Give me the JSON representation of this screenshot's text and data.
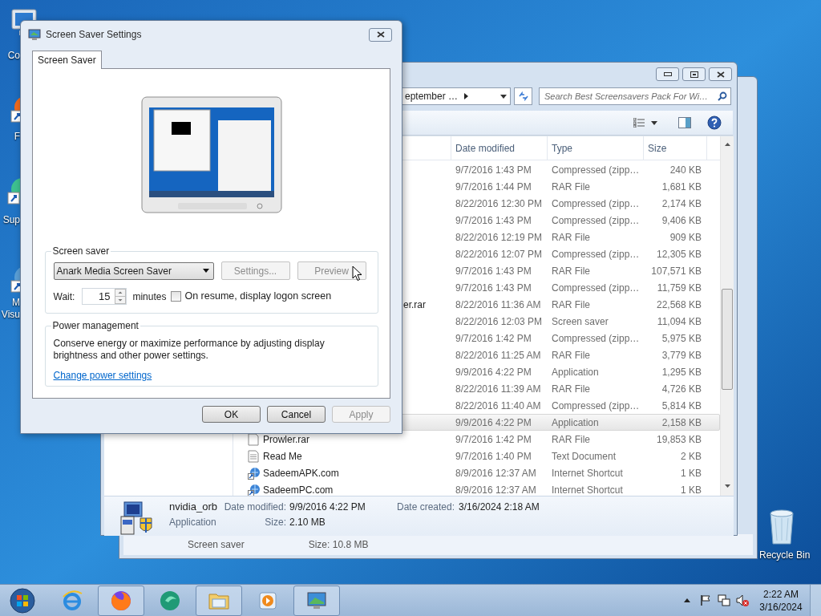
{
  "desktop_icons": [
    {
      "kind": "computer",
      "lines": [
        "Co"
      ]
    },
    {
      "kind": "browser",
      "lines": [
        "F"
      ]
    },
    {
      "kind": "sphere",
      "lines": [
        "Sup"
      ]
    },
    {
      "kind": "globe",
      "lines": [
        "M",
        "Visu"
      ]
    }
  ],
  "recycle_bin": {
    "label": "Recycle Bin"
  },
  "back_window": {
    "status_texts": [
      "Screen saver",
      "Size: 10.8 MB"
    ]
  },
  "explorer": {
    "address": "eptember …",
    "search": {
      "placeholder": "Search Best Screensavers Pack For Wi…"
    },
    "columns": [
      "Date modified",
      "Type",
      "Size"
    ],
    "rows": [
      {
        "kind": "hidden",
        "date": "9/7/2016 1:43 PM",
        "type": "Compressed (zipp…",
        "size": "240 KB",
        "selected": false
      },
      {
        "kind": "hidden",
        "date": "9/7/2016 1:44 PM",
        "type": "RAR File",
        "size": "1,681 KB",
        "selected": false
      },
      {
        "kind": "hidden",
        "date": "8/22/2016 12:30 PM",
        "type": "Compressed (zipp…",
        "size": "2,174 KB",
        "selected": false
      },
      {
        "kind": "hidden",
        "date": "9/7/2016 1:43 PM",
        "type": "Compressed (zipp…",
        "size": "9,406 KB",
        "selected": false
      },
      {
        "kind": "hidden",
        "date": "8/22/2016 12:19 PM",
        "type": "RAR File",
        "size": "909 KB",
        "selected": false
      },
      {
        "kind": "hidden",
        "date": "8/22/2016 12:07 PM",
        "type": "Compressed (zipp…",
        "size": "12,305 KB",
        "selected": false
      },
      {
        "kind": "hidden",
        "date": "9/7/2016 1:43 PM",
        "type": "RAR File",
        "size": "107,571 KB",
        "selected": false
      },
      {
        "kind": "hidden",
        "date": "9/7/2016 1:43 PM",
        "type": "Compressed (zipp…",
        "size": "11,759 KB",
        "selected": false
      },
      {
        "kind": "cut",
        "name": "er.rar",
        "date": "8/22/2016 11:36 AM",
        "type": "RAR File",
        "size": "22,568 KB",
        "selected": false
      },
      {
        "kind": "hidden",
        "date": "8/22/2016 12:03 PM",
        "type": "Screen saver",
        "size": "11,094 KB",
        "selected": false
      },
      {
        "kind": "hidden",
        "date": "9/7/2016 1:42 PM",
        "type": "Compressed (zipp…",
        "size": "5,975 KB",
        "selected": false
      },
      {
        "kind": "hidden",
        "date": "8/22/2016 11:25 AM",
        "type": "RAR File",
        "size": "3,779 KB",
        "selected": false
      },
      {
        "kind": "hidden",
        "date": "9/9/2016 4:22 PM",
        "type": "Application",
        "size": "1,295 KB",
        "selected": false
      },
      {
        "kind": "hidden",
        "date": "8/22/2016 11:39 AM",
        "type": "RAR File",
        "size": "4,726 KB",
        "selected": false
      },
      {
        "kind": "hidden",
        "date": "8/22/2016 11:40 AM",
        "type": "Compressed (zipp…",
        "size": "5,814 KB",
        "selected": false
      },
      {
        "kind": "hidden",
        "date": "9/9/2016 4:22 PM",
        "type": "Application",
        "size": "2,158 KB",
        "selected": true
      },
      {
        "kind": "rar",
        "name": "Prowler.rar",
        "date": "9/7/2016 1:42 PM",
        "type": "RAR File",
        "size": "19,853 KB",
        "selected": false
      },
      {
        "kind": "text",
        "name": "Read Me",
        "date": "9/7/2016 1:40 PM",
        "type": "Text Document",
        "size": "2 KB",
        "selected": false
      },
      {
        "kind": "shortcut",
        "name": "SadeemAPK.com",
        "date": "8/9/2016 12:37 AM",
        "type": "Internet Shortcut",
        "size": "1 KB",
        "selected": false
      },
      {
        "kind": "shortcut",
        "name": "SadeemPC.com",
        "date": "8/9/2016 12:37 AM",
        "type": "Internet Shortcut",
        "size": "1 KB",
        "selected": false
      }
    ],
    "details": {
      "name": "nvidia_orb",
      "type": "Application",
      "modified_label": "Date modified:",
      "modified": "9/9/2016 4:22 PM",
      "size_label": "Size:",
      "size": "2.10 MB",
      "created_label": "Date created:",
      "created": "3/16/2024 2:18 AM"
    }
  },
  "dialog": {
    "title": "Screen Saver Settings",
    "tabs": [
      {
        "label": "Screen Saver",
        "selected": true
      }
    ],
    "screen_saver_group": {
      "legend": "Screen saver",
      "dropdown": "Anark Media Screen Saver",
      "buttons": [
        {
          "label": "Settings...",
          "disabled": true
        },
        {
          "label": "Preview",
          "disabled": true
        }
      ],
      "wait_label": "Wait:",
      "wait_value": "15",
      "wait_unit": "minutes",
      "logon_checkbox": {
        "label": "On resume, display logon screen",
        "checked": false
      }
    },
    "power_group": {
      "legend": "Power management",
      "text": "Conserve energy or maximize performance by adjusting display brightness and other power settings.",
      "link": "Change power settings"
    },
    "buttons": [
      {
        "label": "OK",
        "disabled": false
      },
      {
        "label": "Cancel",
        "disabled": false
      },
      {
        "label": "Apply",
        "disabled": true
      }
    ]
  },
  "taskbar": {
    "apps": [
      {
        "kind": "ie",
        "running": false
      },
      {
        "kind": "firefox",
        "running": true
      },
      {
        "kind": "sphere",
        "running": false
      },
      {
        "kind": "folder",
        "running": true
      },
      {
        "kind": "player",
        "running": false
      },
      {
        "kind": "monitor",
        "running": true
      }
    ],
    "clock": {
      "time": "2:22 AM",
      "date": "3/16/2024"
    }
  }
}
